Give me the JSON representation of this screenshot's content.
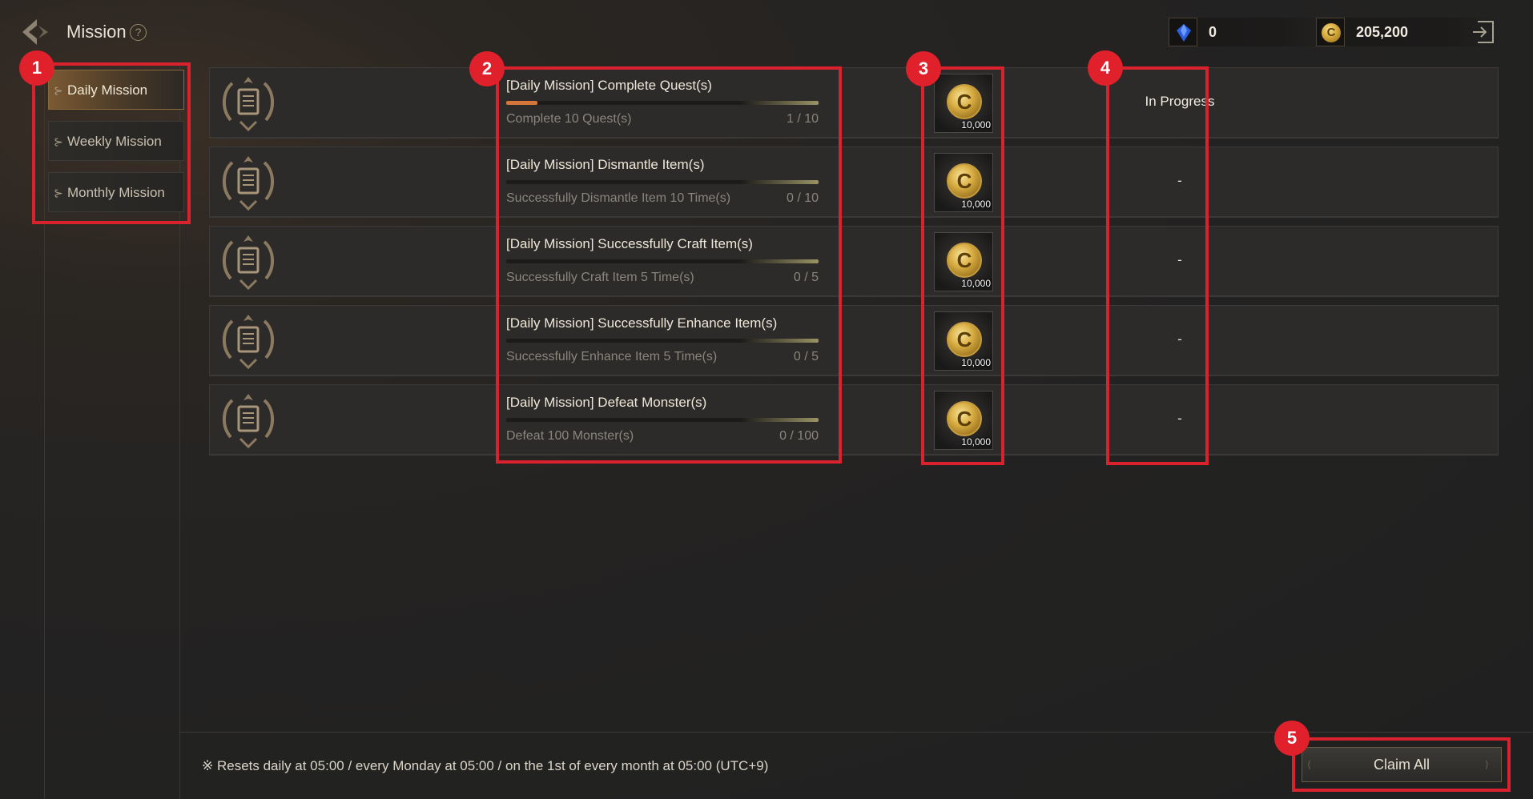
{
  "header": {
    "title": "Mission",
    "help_symbol": "?",
    "gem_count": "0",
    "gold_count": "205,200",
    "coin_symbol": "C"
  },
  "sidebar": {
    "tabs": [
      {
        "label": "Daily Mission",
        "active": true
      },
      {
        "label": "Weekly Mission",
        "active": false
      },
      {
        "label": "Monthly Mission",
        "active": false
      }
    ]
  },
  "missions": [
    {
      "title": "[Daily Mission] Complete Quest(s)",
      "desc": "Complete 10 Quest(s)",
      "count": "1 / 10",
      "progress": 0.1,
      "reward_symbol": "C",
      "reward_amount": "10,000",
      "status": "In Progress"
    },
    {
      "title": "[Daily Mission] Dismantle Item(s)",
      "desc": "Successfully Dismantle Item 10 Time(s)",
      "count": "0 / 10",
      "progress": 0,
      "reward_symbol": "C",
      "reward_amount": "10,000",
      "status": "-"
    },
    {
      "title": "[Daily Mission] Successfully Craft Item(s)",
      "desc": "Successfully Craft Item 5 Time(s)",
      "count": "0 / 5",
      "progress": 0,
      "reward_symbol": "C",
      "reward_amount": "10,000",
      "status": "-"
    },
    {
      "title": "[Daily Mission] Successfully Enhance Item(s)",
      "desc": "Successfully Enhance Item 5 Time(s)",
      "count": "0 / 5",
      "progress": 0,
      "reward_symbol": "C",
      "reward_amount": "10,000",
      "status": "-"
    },
    {
      "title": "[Daily Mission] Defeat Monster(s)",
      "desc": "Defeat 100 Monster(s)",
      "count": "0 / 100",
      "progress": 0,
      "reward_symbol": "C",
      "reward_amount": "10,000",
      "status": "-"
    }
  ],
  "footer": {
    "reset_note": "※ Resets daily at 05:00 / every Monday at 05:00 / on the 1st of every month at 05:00 (UTC+9)",
    "claim_all_label": "Claim All"
  },
  "annotations": [
    "1",
    "2",
    "3",
    "4",
    "5"
  ],
  "colors": {
    "annotation": "#d9222d",
    "progress": "#d4763a",
    "active_tab": "#7a5a33"
  }
}
